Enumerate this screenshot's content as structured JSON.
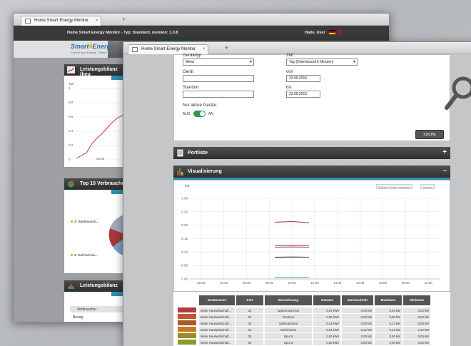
{
  "window_back": {
    "tab_title": "Home Smart Energy Monitor",
    "header_title": "Home Smart Energy Monitor - Typ: Standard, revision: 1.0.8",
    "greeting": "Hallo,  User",
    "logo_main_a": "Smart",
    "logo_main_b": "4",
    "logo_main_c": "Energy",
    "logo_sub": "Control your Energy - Smart",
    "panels": {
      "leistung_title": "Leistungsbilanz (heu",
      "leistung_unit": "kW",
      "leistung_yticks": [
        "1",
        "0.8",
        "0.6",
        "0.4",
        "0.2",
        "0"
      ],
      "leistung_xtick": "04:00",
      "top10_title": "Top 10 Verbraucher",
      "top10_labels": [
        "3: Spülmaschi...",
        "2: Gefriertruh..."
      ],
      "bilanz_title": "Leistungsbilanz",
      "bilanz_col": "Verbraucher",
      "bilanz_row": "Bezug"
    }
  },
  "window_front": {
    "tab_title": "Home Smart Energy Monitor",
    "form": {
      "geraetetyp_label": "Gerätetyp",
      "geraetetyp_value": "Meter",
      "geraet_label": "Gerät",
      "standort_label": "Standort",
      "aktiv_label": "Nur aktive Geräte:",
      "aus_label": "AUS",
      "an_label": "AN",
      "zeit_label": "Zeit",
      "zeit_value": "Tag (Datenbasis15 Minuten)",
      "von_label": "von",
      "von_value": "23.09.2015",
      "bis_label": "bis",
      "bis_value": "23.09.2015",
      "search_button": "SUCHE"
    },
    "portliste_title": "Portliste",
    "visual_title": "Visualisierung",
    "chart_buttons": [
      "Balken / Linien  umformen",
      "Summe"
    ],
    "colors": {
      "accent": "#2b8fb3",
      "toggle": "#2f9a4a"
    },
    "table": {
      "headers": [
        "Gerätename",
        "Port",
        "Bezeichnung",
        "Gesamt",
        "Durchschnitt",
        "Maximum",
        "Minimum"
      ],
      "rows": [
        {
          "color": "#b23a3a",
          "cells": [
            "Meter Hauswirtschaft...",
            "01",
            "Waschmaschine",
            "0,04 kWh",
            "0,00 kW",
            "0,01 kW",
            "0,00 kW"
          ]
        },
        {
          "color": "#c0562f",
          "cells": [
            "Meter Hauswirtschaft...",
            "02",
            "Trockner",
            "0,00 kWh",
            "0,00 kW",
            "0,00 kW",
            "0,00 kW"
          ]
        },
        {
          "color": "#a85a2a",
          "cells": [
            "Meter Hauswirtschaft...",
            "03",
            "Spülmaschine",
            "0,43 kWh",
            "0,00 kW",
            "0,12 kW",
            "0,08 kW"
          ]
        },
        {
          "color": "#c47a25",
          "cells": [
            "Meter Hauswirtschaft...",
            "04",
            "Gefriertruhe",
            "0,64 kWh",
            "0,12 kW",
            "0,12 kW",
            "0,12 kW"
          ]
        },
        {
          "color": "#a08a28",
          "cells": [
            "Meter Hauswirtschaft...",
            "05",
            "Input 5",
            "0,00 kWh",
            "0,00 kW",
            "0,00 kW",
            "0,00 kW"
          ]
        },
        {
          "color": "#8c9a2c",
          "cells": [
            "Meter Hauswirtschaft...",
            "06",
            "Input 6",
            "0,00 kWh",
            "0,00 kW",
            "0,00 kW",
            "0,00 kW"
          ]
        },
        {
          "color": "#74a030",
          "cells": [
            "Meter Hauswirtschaft...",
            "07",
            "Input 7",
            "0,00 kWh",
            "0,00 kW",
            "0,00 kW",
            "0,00 kW"
          ]
        },
        {
          "color": "#5e9a36",
          "cells": [
            "Meter Hauswirtschaft...",
            "08",
            "Input 8",
            "0,00 kWh",
            "0,00 kW",
            "0,00 kW",
            "0,00 kW"
          ]
        }
      ]
    }
  },
  "chart_data": {
    "type": "line",
    "ylabel": "kW",
    "ylim": [
      0,
      0.3
    ],
    "yticks": [
      "0.30",
      "0.25",
      "0.20",
      "0.15",
      "0.10",
      "0.05",
      "0.00"
    ],
    "categories": [
      "02:00",
      "04:00",
      "06:00",
      "08:00",
      "10:00",
      "12:00",
      "14:00",
      "16:00",
      "18:00",
      "20:00",
      "22:00"
    ],
    "xrange": [
      1,
      23
    ],
    "series": [
      {
        "color": "#a04060",
        "x": [
          8.5,
          10,
          11.5
        ],
        "values": [
          0.211,
          0.214,
          0.209
        ]
      },
      {
        "color": "#8050a0",
        "x": [
          8.5,
          10,
          11.5
        ],
        "values": [
          0.124,
          0.125,
          0.124
        ]
      },
      {
        "color": "#d04a4a",
        "x": [
          8.5,
          10,
          11.5
        ],
        "values": [
          0.118,
          0.119,
          0.118
        ]
      },
      {
        "color": "#3a4ab0",
        "x": [
          8.5,
          10,
          11.5
        ],
        "values": [
          0.081,
          0.082,
          0.081
        ]
      },
      {
        "color": "#8a7a3a",
        "x": [
          8.5,
          10,
          11.5
        ],
        "values": [
          0.079,
          0.08,
          0.08
        ]
      },
      {
        "color": "#30a0a0",
        "x": [
          8.5,
          10,
          11.5
        ],
        "values": [
          0.006,
          0.006,
          0.006
        ]
      }
    ]
  },
  "chart_data_back": {
    "type": "line",
    "ylabel": "kW",
    "ylim": [
      0,
      1
    ],
    "series": [
      {
        "color": "#c23b3b",
        "x": [
          0,
          1,
          2,
          3,
          4,
          5,
          6,
          7,
          8,
          9,
          10
        ],
        "values": [
          0.02,
          0.06,
          0.1,
          0.22,
          0.3,
          0.36,
          0.44,
          0.52,
          0.58,
          0.62,
          0.68
        ]
      }
    ]
  }
}
